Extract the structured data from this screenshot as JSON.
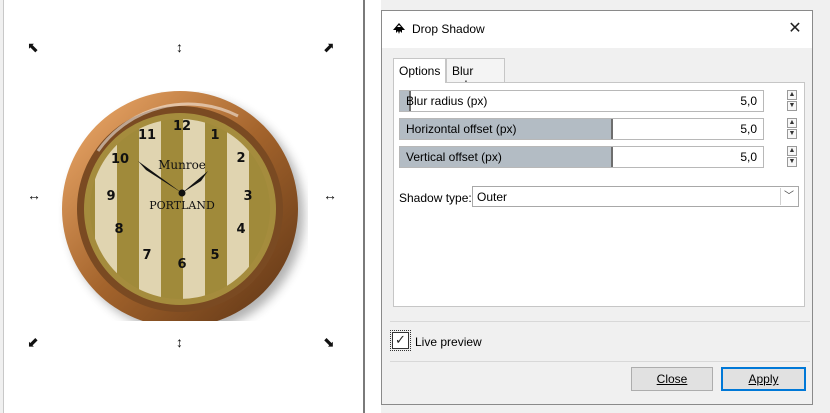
{
  "canvas": {
    "clock": {
      "brand_line1": "Munroe",
      "brand_line2": "PORTLAND",
      "numbers": [
        "12",
        "1",
        "2",
        "3",
        "4",
        "5",
        "6",
        "7",
        "8",
        "9",
        "10",
        "11"
      ]
    },
    "handles": {
      "corner_nw": "⬉",
      "corner_ne": "⬈",
      "corner_sw": "⬋",
      "corner_se": "⬊",
      "edge_top": "↕",
      "edge_bottom": "↕",
      "edge_left": "↔",
      "edge_right": "↔"
    }
  },
  "dialog": {
    "title": "Drop Shadow",
    "close_glyph": "✕",
    "tabs": [
      {
        "label": "Options",
        "active": true
      },
      {
        "label": "Blur color",
        "active": false
      }
    ],
    "options": {
      "blur_radius": {
        "label": "Blur radius (px)",
        "value": "5,0",
        "fill_fraction": 0.03
      },
      "horizontal_offset": {
        "label": "Horizontal offset (px)",
        "value": "5,0",
        "fill_fraction": 0.58
      },
      "vertical_offset": {
        "label": "Vertical offset (px)",
        "value": "5,0",
        "fill_fraction": 0.58
      },
      "shadow_type": {
        "label": "Shadow type:",
        "value": "Outer"
      }
    },
    "live_preview": {
      "label": "Live preview",
      "checked": true
    },
    "buttons": {
      "close": "Close",
      "apply": "Apply"
    }
  },
  "colors": {
    "accent": "#0078d7",
    "slider_fill": "#b3bcc4",
    "clock_rim": "#a0622e",
    "clock_stripe_dark": "#a08a3a",
    "clock_stripe_light": "#e0d4b0"
  }
}
